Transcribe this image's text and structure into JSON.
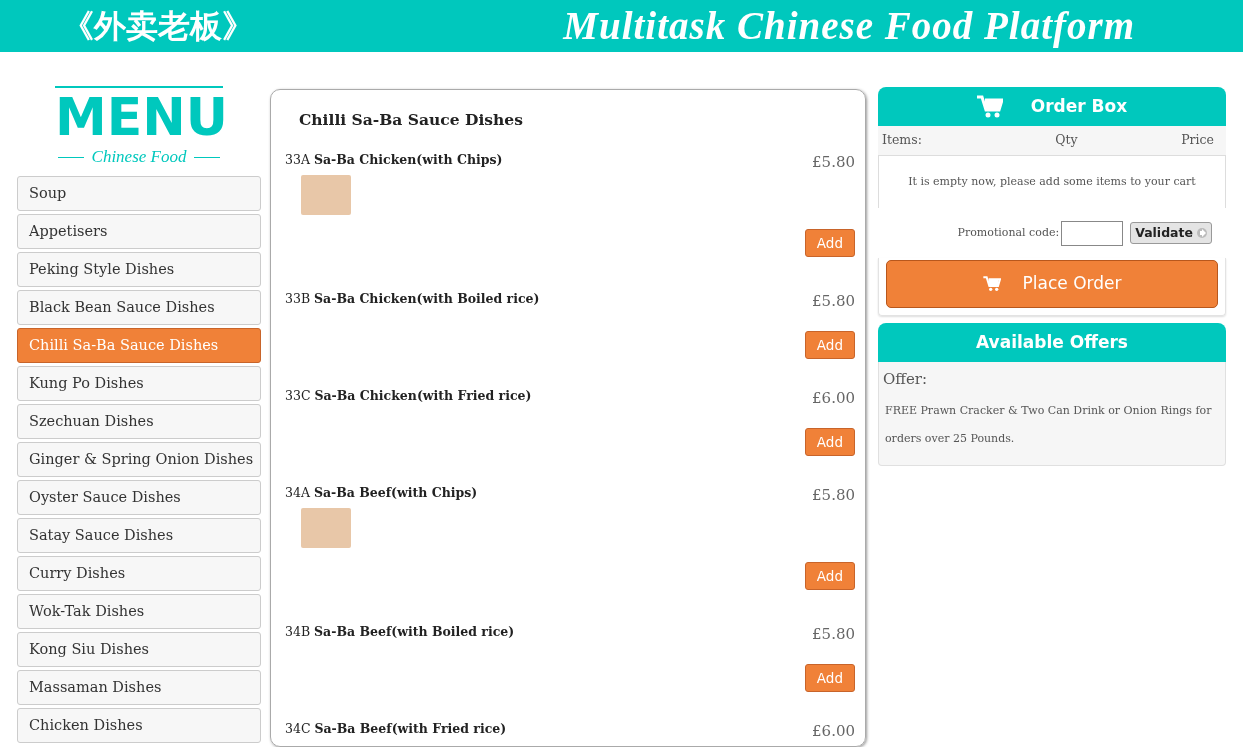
{
  "header": {
    "chinese_title": "《外卖老板》",
    "english_title": "Multitask Chinese Food Platform"
  },
  "logo": {
    "title": "MENU",
    "subtitle": "Chinese Food"
  },
  "sidebar": {
    "items": [
      {
        "label": "Soup",
        "selected": false
      },
      {
        "label": "Appetisers",
        "selected": false
      },
      {
        "label": "Peking Style Dishes",
        "selected": false
      },
      {
        "label": "Black Bean Sauce Dishes",
        "selected": false
      },
      {
        "label": "Chilli Sa-Ba Sauce Dishes",
        "selected": true
      },
      {
        "label": "Kung Po Dishes",
        "selected": false
      },
      {
        "label": "Szechuan Dishes",
        "selected": false
      },
      {
        "label": "Ginger & Spring Onion Dishes",
        "selected": false
      },
      {
        "label": "Oyster Sauce Dishes",
        "selected": false
      },
      {
        "label": "Satay Sauce Dishes",
        "selected": false
      },
      {
        "label": "Curry Dishes",
        "selected": false
      },
      {
        "label": "Wok-Tak Dishes",
        "selected": false
      },
      {
        "label": "Kong Siu Dishes",
        "selected": false
      },
      {
        "label": "Massaman Dishes",
        "selected": false
      },
      {
        "label": "Chicken Dishes",
        "selected": false
      }
    ]
  },
  "menu": {
    "title": "Chilli Sa-Ba Sauce Dishes",
    "dishes": [
      {
        "code": "33A",
        "name": "Sa-Ba Chicken(with Chips)",
        "price": "£5.80",
        "photo": true,
        "add_button": "Add"
      },
      {
        "code": "33B",
        "name": "Sa-Ba Chicken(with Boiled rice)",
        "price": "£5.80",
        "photo": false,
        "add_button": "Add"
      },
      {
        "code": "33C",
        "name": "Sa-Ba Chicken(with Fried rice)",
        "price": "£6.00",
        "photo": false,
        "add_button": "Add"
      },
      {
        "code": "34A",
        "name": "Sa-Ba Beef(with Chips)",
        "price": "£5.80",
        "photo": true,
        "add_button": "Add"
      },
      {
        "code": "34B",
        "name": "Sa-Ba Beef(with Boiled rice)",
        "price": "£5.80",
        "photo": false,
        "add_button": "Add"
      },
      {
        "code": "34C",
        "name": "Sa-Ba Beef(with Fried rice)",
        "price": "£6.00",
        "photo": false
      }
    ]
  },
  "order_box": {
    "title": "Order Box",
    "columns": [
      "Items:",
      "Qty",
      "Price"
    ],
    "empty_message": "It is empty now, please add some items to your cart",
    "promo_label": "Promotional code:",
    "validate_button": "Validate",
    "place_order_button": "Place Order"
  },
  "offers": {
    "title": "Available Offers",
    "label": "Offer:",
    "text": "FREE Prawn Cracker & Two Can Drink or Onion Rings for orders over 25 Pounds."
  }
}
